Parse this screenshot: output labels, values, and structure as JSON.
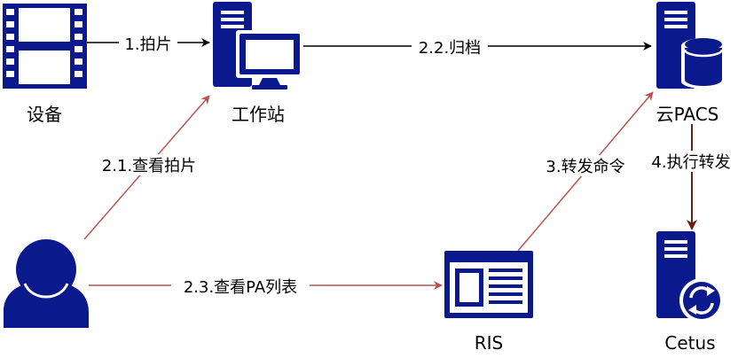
{
  "colors": {
    "icon_blue": "#0a1a8c",
    "arrow_black": "#000000",
    "arrow_red": "#b85450",
    "arrow_brown": "#6b1f0c"
  },
  "nodes": {
    "device": {
      "label": "设备",
      "icon": "film-icon"
    },
    "workstation": {
      "label": "工作站",
      "icon": "workstation-icon"
    },
    "cloud_pacs": {
      "label": "云PACS",
      "icon": "database-server-icon"
    },
    "user": {
      "label": "",
      "icon": "user-icon"
    },
    "ris": {
      "label": "RIS",
      "icon": "browser-window-icon"
    },
    "cetus": {
      "label": "Cetus",
      "icon": "sync-server-icon"
    }
  },
  "edges": {
    "capture": "1.拍片",
    "archive": "2.2.归档",
    "view_capture": "2.1.查看拍片",
    "view_pa_list": "2.3.查看PA列表",
    "forward_command": "3.转发命令",
    "execute_forward": "4.执行转发"
  }
}
